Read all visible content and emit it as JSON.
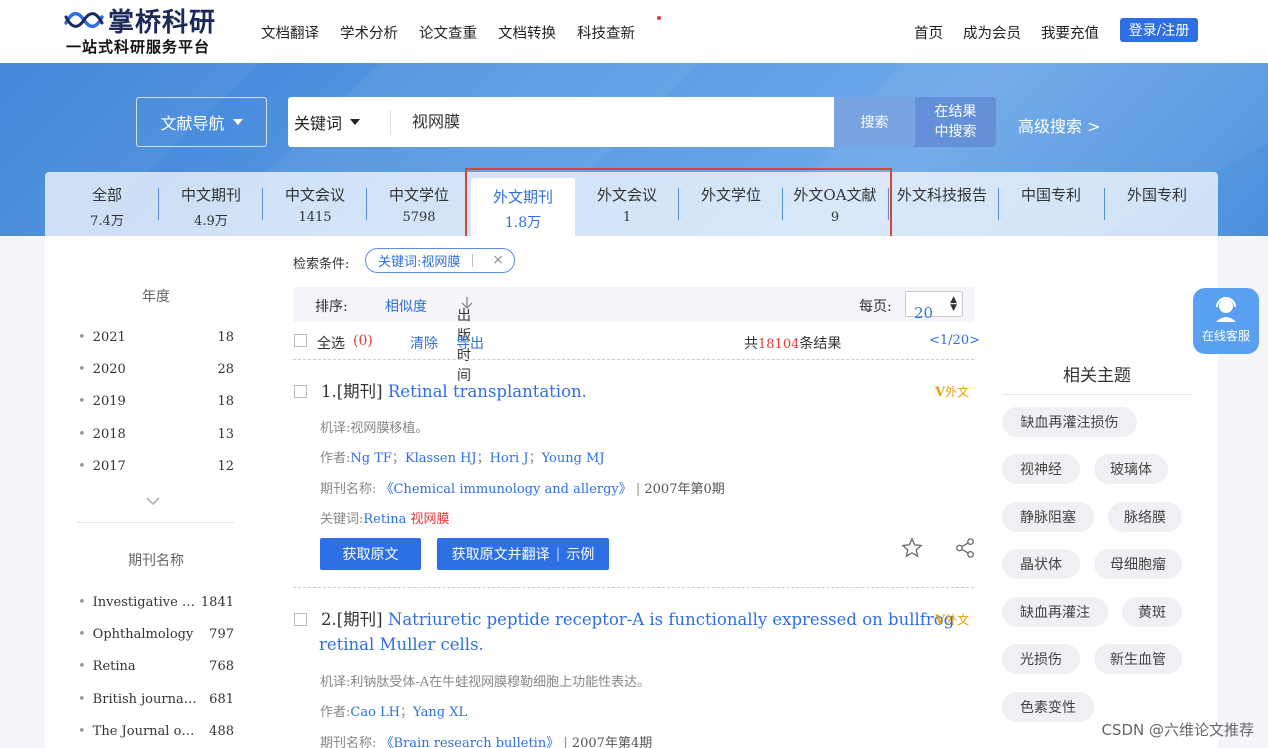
{
  "header": {
    "logo_name": "掌桥科研",
    "logo_tagline": "一站式科研服务平台",
    "nav": [
      "文档翻译",
      "学术分析",
      "论文查重",
      "文档转换",
      "科技查新"
    ],
    "right_nav": [
      "首页",
      "成为会员",
      "我要充值"
    ],
    "login_label": "登录/注册"
  },
  "search": {
    "nav_button": "文献导航",
    "field": "关键词",
    "query": "视网膜",
    "search_button": "搜索",
    "in_results_line1": "在结果",
    "in_results_line2": "中搜索",
    "advanced": "高级搜索 >"
  },
  "tabs": [
    {
      "label": "全部",
      "count": "7.4万"
    },
    {
      "label": "中文期刊",
      "count": "4.9万"
    },
    {
      "label": "中文会议",
      "count": "1415"
    },
    {
      "label": "中文学位",
      "count": "5798"
    },
    {
      "label": "外文期刊",
      "count": "1.8万"
    },
    {
      "label": "外文会议",
      "count": "1"
    },
    {
      "label": "外文学位",
      "count": ""
    },
    {
      "label": "外文OA文献",
      "count": "9"
    },
    {
      "label": "外文科技报告",
      "count": ""
    },
    {
      "label": "中国专利",
      "count": ""
    },
    {
      "label": "外国专利",
      "count": ""
    }
  ],
  "sidebar": {
    "year_heading": "年度",
    "years": [
      {
        "label": "2021",
        "count": "18"
      },
      {
        "label": "2020",
        "count": "28"
      },
      {
        "label": "2019",
        "count": "18"
      },
      {
        "label": "2018",
        "count": "13"
      },
      {
        "label": "2017",
        "count": "12"
      }
    ],
    "journal_heading": "期刊名称",
    "journals": [
      {
        "label": "Investigative …",
        "count": "1841"
      },
      {
        "label": "Ophthalmology",
        "count": "797"
      },
      {
        "label": "Retina",
        "count": "768"
      },
      {
        "label": "British journa…",
        "count": "681"
      },
      {
        "label": "The Journal o…",
        "count": "488"
      }
    ]
  },
  "conditions": {
    "label": "检索条件:",
    "chip": "关键词:视网膜"
  },
  "sort": {
    "label": "排序:",
    "relevance": "相似度",
    "date": "出版时间",
    "per_page_label": "每页:",
    "per_page": "20"
  },
  "select_row": {
    "select_all": "全选",
    "selected": "(0)",
    "clear": "清除",
    "export": "导出",
    "total_prefix": "共",
    "total": "18104",
    "total_suffix": "条结果",
    "page": "<1/20>"
  },
  "results": [
    {
      "index": "1.[期刊]",
      "title": "Retinal transplantation.",
      "translation_label": "机译:",
      "translation": "视网膜移植。",
      "authors_label": "作者:",
      "authors": [
        "Ng TF",
        "Klassen HJ",
        "Hori J",
        "Young MJ"
      ],
      "journal_label": "期刊名称:",
      "journal": "《Chemical immunology and allergy》",
      "issue": "2007年第0期",
      "keywords_label": "关键词:",
      "keywords": [
        "Retina",
        "视网膜"
      ],
      "badge": "外文"
    },
    {
      "index": "2.[期刊]",
      "title_line1": "Natriuretic peptide receptor-A is functionally expressed on bullfrog",
      "title_line2": "retinal Muller cells.",
      "translation_label": "机译:",
      "translation": "利钠肽受体-A在牛蛙视网膜穆勒细胞上功能性表达。",
      "authors_label": "作者:",
      "authors": [
        "Cao LH",
        "Yang XL"
      ],
      "journal_label": "期刊名称:",
      "journal": "《Brain research bulletin》",
      "issue": "2007年第4期",
      "badge": "外文"
    }
  ],
  "actions": {
    "get_full": "获取原文",
    "get_translate": "获取原文并翻译",
    "example": "示例"
  },
  "related": {
    "heading": "相关主题",
    "tags": [
      "缺血再灌注损伤",
      "视神经",
      "玻璃体",
      "静脉阻塞",
      "脉络膜",
      "晶状体",
      "母细胞瘤",
      "缺血再灌注",
      "黄斑",
      "光损伤",
      "新生血管",
      "色素变性"
    ]
  },
  "float_service": "在线客服",
  "watermark": "CSDN @六维论文推荐"
}
